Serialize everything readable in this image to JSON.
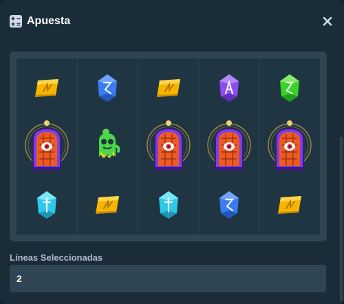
{
  "modal": {
    "title": "Apuesta"
  },
  "lines": {
    "label": "Líneas Seleccionadas",
    "value": "2"
  },
  "reels": [
    [
      "yellow-gem",
      "portal",
      "cyan-gem"
    ],
    [
      "blue-gem",
      "green-ghost",
      "yellow-gem"
    ],
    [
      "yellow-gem",
      "portal",
      "cyan-gem"
    ],
    [
      "purple-gem",
      "portal",
      "blue-gem"
    ],
    [
      "green-gem",
      "portal",
      "yellow-gem"
    ]
  ],
  "colors": {
    "background": "#1a2c38",
    "board": "#2f4553",
    "accent_orange": "#f05a22",
    "portal_purple": "#7b3fe4"
  }
}
